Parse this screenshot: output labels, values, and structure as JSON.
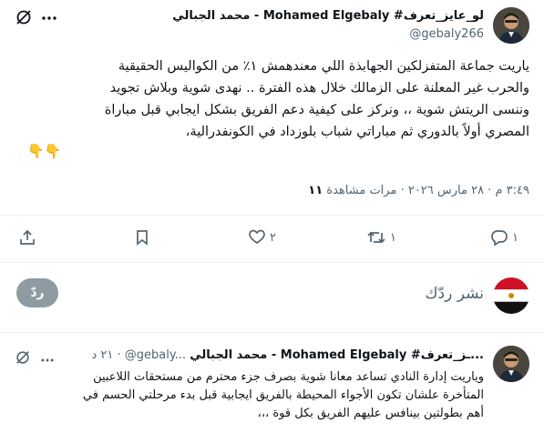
{
  "main_tweet": {
    "display_name": "لو_عايز_تعرف# Mohamed Elgebaly - محمد الجبالي",
    "handle": "@gebaly266",
    "text_lines": [
      "ياريت جماعة المتفزلكين الجهابذة اللي معندهمش ١٪ من الكواليس الحقيقية",
      "والحرب غير المعلنة على الزمالك خلال هذه الفترة .. نهدى شوية وبلاش تجويد",
      "وننسى الريتش شوية ،، ونركز على كيفية دعم الفريق بشكل ايجابي قبل مباراة",
      "المصري أولاً بالدوري ثم مباراتي شباب بلوزداد في الكونفدرالية،"
    ],
    "emojis": "👇👇",
    "timestamp": "٣:٤٩ م · ٢٨ مارس ٢٠٢٦",
    "views_count": "١١",
    "views_label": "مرات مشاهدة"
  },
  "actions": {
    "reply_count": "١",
    "retweet_count": "١",
    "like_count": "٢"
  },
  "composer": {
    "placeholder": "نشر ردّك",
    "reply_button": "ردّ"
  },
  "reply_tweet": {
    "display_name_prefix": "...ـز_تعرف# Mohamed Elgebaly - محمد الجبالي",
    "handle": "@gebaly...",
    "time": "٢١ د",
    "text_lines": [
      "وياريت إدارة النادي تساعد معانا شوية بصرف جزء محترم من مستحقات اللاعبين",
      "المتأخرة علشان تكون الأجواء المحيطة بالفريق ايجابية قبل بدء مرحلتي الحسم في",
      "أهم بطولتين بينافس عليهم الفريق بكل قوة ،،،"
    ]
  },
  "icons": {
    "grok": "grok-icon",
    "share": "share-icon",
    "bookmark": "bookmark-icon",
    "like": "heart-icon",
    "retweet": "retweet-icon",
    "reply": "reply-icon"
  },
  "colors": {
    "text": "#0f1419",
    "muted": "#536471",
    "divider": "#eff3f4",
    "reply_button": "#8e9ba3"
  }
}
